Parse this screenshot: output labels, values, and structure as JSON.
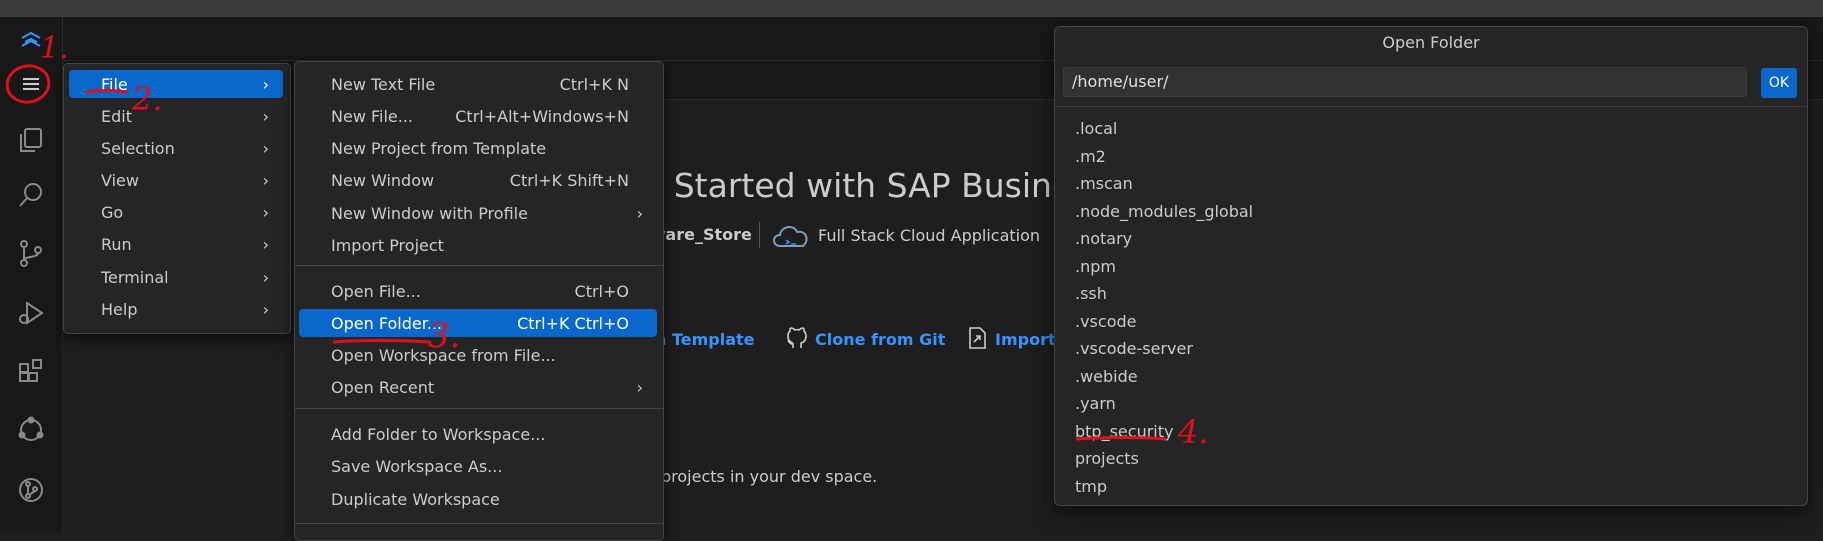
{
  "menu": {
    "items": [
      {
        "label": "File"
      },
      {
        "label": "Edit"
      },
      {
        "label": "Selection"
      },
      {
        "label": "View"
      },
      {
        "label": "Go"
      },
      {
        "label": "Run"
      },
      {
        "label": "Terminal"
      },
      {
        "label": "Help"
      }
    ]
  },
  "file_menu": {
    "groups": [
      [
        {
          "label": "New Text File",
          "shortcut": "Ctrl+K N"
        },
        {
          "label": "New File...",
          "shortcut": "Ctrl+Alt+Windows+N"
        },
        {
          "label": "New Project from Template",
          "shortcut": ""
        },
        {
          "label": "New Window",
          "shortcut": "Ctrl+K Shift+N"
        },
        {
          "label": "New Window with Profile",
          "shortcut": ""
        },
        {
          "label": "Import Project",
          "shortcut": ""
        }
      ],
      [
        {
          "label": "Open File...",
          "shortcut": "Ctrl+O"
        },
        {
          "label": "Open Folder...",
          "shortcut": "Ctrl+K Ctrl+O"
        },
        {
          "label": "Open Workspace from File...",
          "shortcut": ""
        },
        {
          "label": "Open Recent",
          "shortcut": ""
        }
      ],
      [
        {
          "label": "Add Folder to Workspace...",
          "shortcut": ""
        },
        {
          "label": "Save Workspace As...",
          "shortcut": ""
        },
        {
          "label": "Duplicate Workspace",
          "shortcut": ""
        }
      ]
    ]
  },
  "welcome": {
    "title_fragment": "et Started with SAP Busines",
    "recent_project_fragment": "vare_Store",
    "recent_project_2": "Full Stack Cloud Application",
    "actions": [
      {
        "label": "n Template"
      },
      {
        "label": "Clone from Git"
      },
      {
        "label": "Import"
      }
    ],
    "footer_fragment": "projects in your dev space."
  },
  "dialog": {
    "title": "Open Folder",
    "path_value": "/home/user/",
    "ok_label": "OK",
    "folders": [
      ".local",
      ".m2",
      ".mscan",
      ".node_modules_global",
      ".notary",
      ".npm",
      ".ssh",
      ".vscode",
      ".vscode-server",
      ".webide",
      ".yarn",
      "btp_security",
      "projects",
      "tmp"
    ]
  },
  "annotations": {
    "step1": "1.",
    "step2": "2.",
    "step3": "3.",
    "step4": "4."
  },
  "colors": {
    "accent": "#0a68cc",
    "link": "#3794ff",
    "annotation": "#e0101a"
  }
}
